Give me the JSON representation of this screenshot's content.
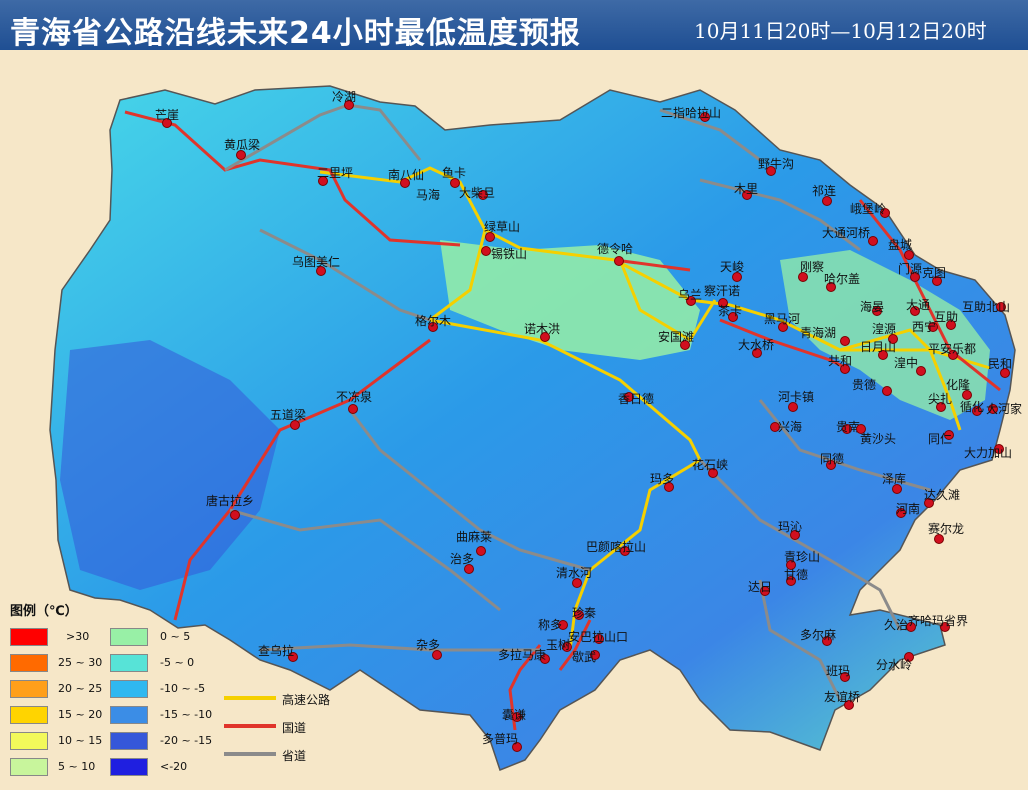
{
  "header": {
    "title": "青海省公路沿线未来24小时最低温度预报",
    "subtitle": "10月11日20时—10月12日20时"
  },
  "legend": {
    "title": "图例（℃）",
    "left_items": [
      {
        "label": ">30",
        "color": "#ff0000"
      },
      {
        "label": "25 ~ 30",
        "color": "#ff6a00"
      },
      {
        "label": "20 ~ 25",
        "color": "#ff9f1a"
      },
      {
        "label": "15 ~ 20",
        "color": "#ffd400"
      },
      {
        "label": "10 ~ 15",
        "color": "#f2f95a"
      },
      {
        "label": "5 ~ 10",
        "color": "#c8f59c"
      }
    ],
    "right_items": [
      {
        "label": "0 ~ 5",
        "color": "#98f0a6"
      },
      {
        "label": "-5 ~ 0",
        "color": "#57e3d7"
      },
      {
        "label": "-10 ~ -5",
        "color": "#2fb8f0"
      },
      {
        "label": "-15 ~ -10",
        "color": "#3b8de6"
      },
      {
        "label": "-20 ~ -15",
        "color": "#3557d9"
      },
      {
        "label": "<-20",
        "color": "#1f1fe0"
      }
    ],
    "roads": [
      {
        "label": "高速公路",
        "color": "#f5d000"
      },
      {
        "label": "国道",
        "color": "#e0342b"
      },
      {
        "label": "省道",
        "color": "#8b8b8b"
      }
    ]
  },
  "places": [
    "芒崖",
    "冷湖",
    "黄瓜梁",
    "二里坪",
    "南八仙",
    "马海",
    "鱼卡",
    "大柴旦",
    "绿草山",
    "锡铁山",
    "乌图美仁",
    "格尔木",
    "诺木洪",
    "德令哈",
    "二指哈拉山",
    "野牛沟",
    "木里",
    "祁连",
    "峨堡岭",
    "大通河桥",
    "盘城",
    "门源",
    "克图",
    "天峻",
    "刚察",
    "哈尔盖",
    "乌兰",
    "察汗诺",
    "茶卡",
    "黑马河",
    "青海湖",
    "海晏",
    "大通",
    "西宁",
    "互助北山",
    "湟源",
    "互助",
    "日月山",
    "平安乐都",
    "民和",
    "湟中",
    "安国滩",
    "大水桥",
    "共和",
    "贵德",
    "化隆",
    "循化",
    "尖扎",
    "大河家",
    "香日德",
    "不冻泉",
    "五道梁",
    "河卡镇",
    "兴海",
    "贵南",
    "黄沙头",
    "同仁",
    "大力加山",
    "同德",
    "花石峡",
    "玛多",
    "泽库",
    "达久滩",
    "河南",
    "唐古拉乡",
    "曲麻莱",
    "玛沁",
    "赛尔龙",
    "巴颜喀拉山",
    "治多",
    "清水河",
    "青珍山",
    "甘德",
    "达日",
    "珍秦",
    "称多",
    "玉树",
    "安巴拉山口",
    "歇武",
    "久治",
    "齐哈玛省界",
    "多尔麻",
    "分水岭",
    "杂多",
    "多拉马康",
    "囊谦",
    "多普玛",
    "查乌拉",
    "班玛",
    "友谊桥"
  ]
}
